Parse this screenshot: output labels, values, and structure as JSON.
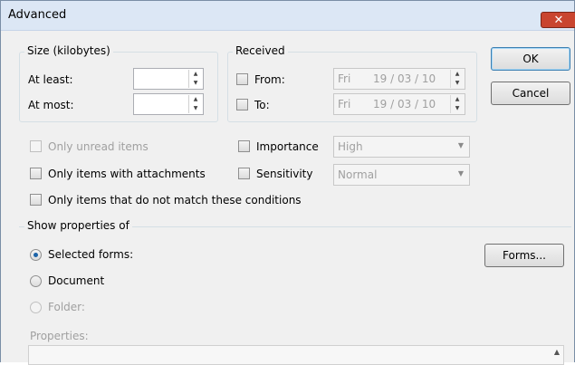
{
  "window": {
    "title": "Advanced",
    "close_glyph": "✕"
  },
  "size_group": {
    "label": "Size (kilobytes)",
    "at_least_label": "At least:",
    "at_least_value": "",
    "at_most_label": "At most:",
    "at_most_value": ""
  },
  "received_group": {
    "label": "Received",
    "from_label": "From:",
    "from_dow": "Fri",
    "from_date": "19 / 03 / 10",
    "to_label": "To:",
    "to_dow": "Fri",
    "to_date": "19 / 03 / 10"
  },
  "buttons": {
    "ok": "OK",
    "cancel": "Cancel",
    "forms": "Forms..."
  },
  "options": {
    "only_unread": "Only unread items",
    "only_attachments": "Only items with attachments",
    "not_match": "Only items that do not match these conditions",
    "importance_label": "Importance",
    "importance_value": "High",
    "sensitivity_label": "Sensitivity",
    "sensitivity_value": "Normal"
  },
  "show_properties": {
    "label": "Show properties of",
    "selected_forms": "Selected forms:",
    "document": "Document",
    "folder": "Folder:",
    "properties_label": "Properties:",
    "selected": "selected_forms"
  },
  "icons": {
    "spin_up": "▲",
    "spin_down": "▼",
    "dropdown": "▼"
  }
}
